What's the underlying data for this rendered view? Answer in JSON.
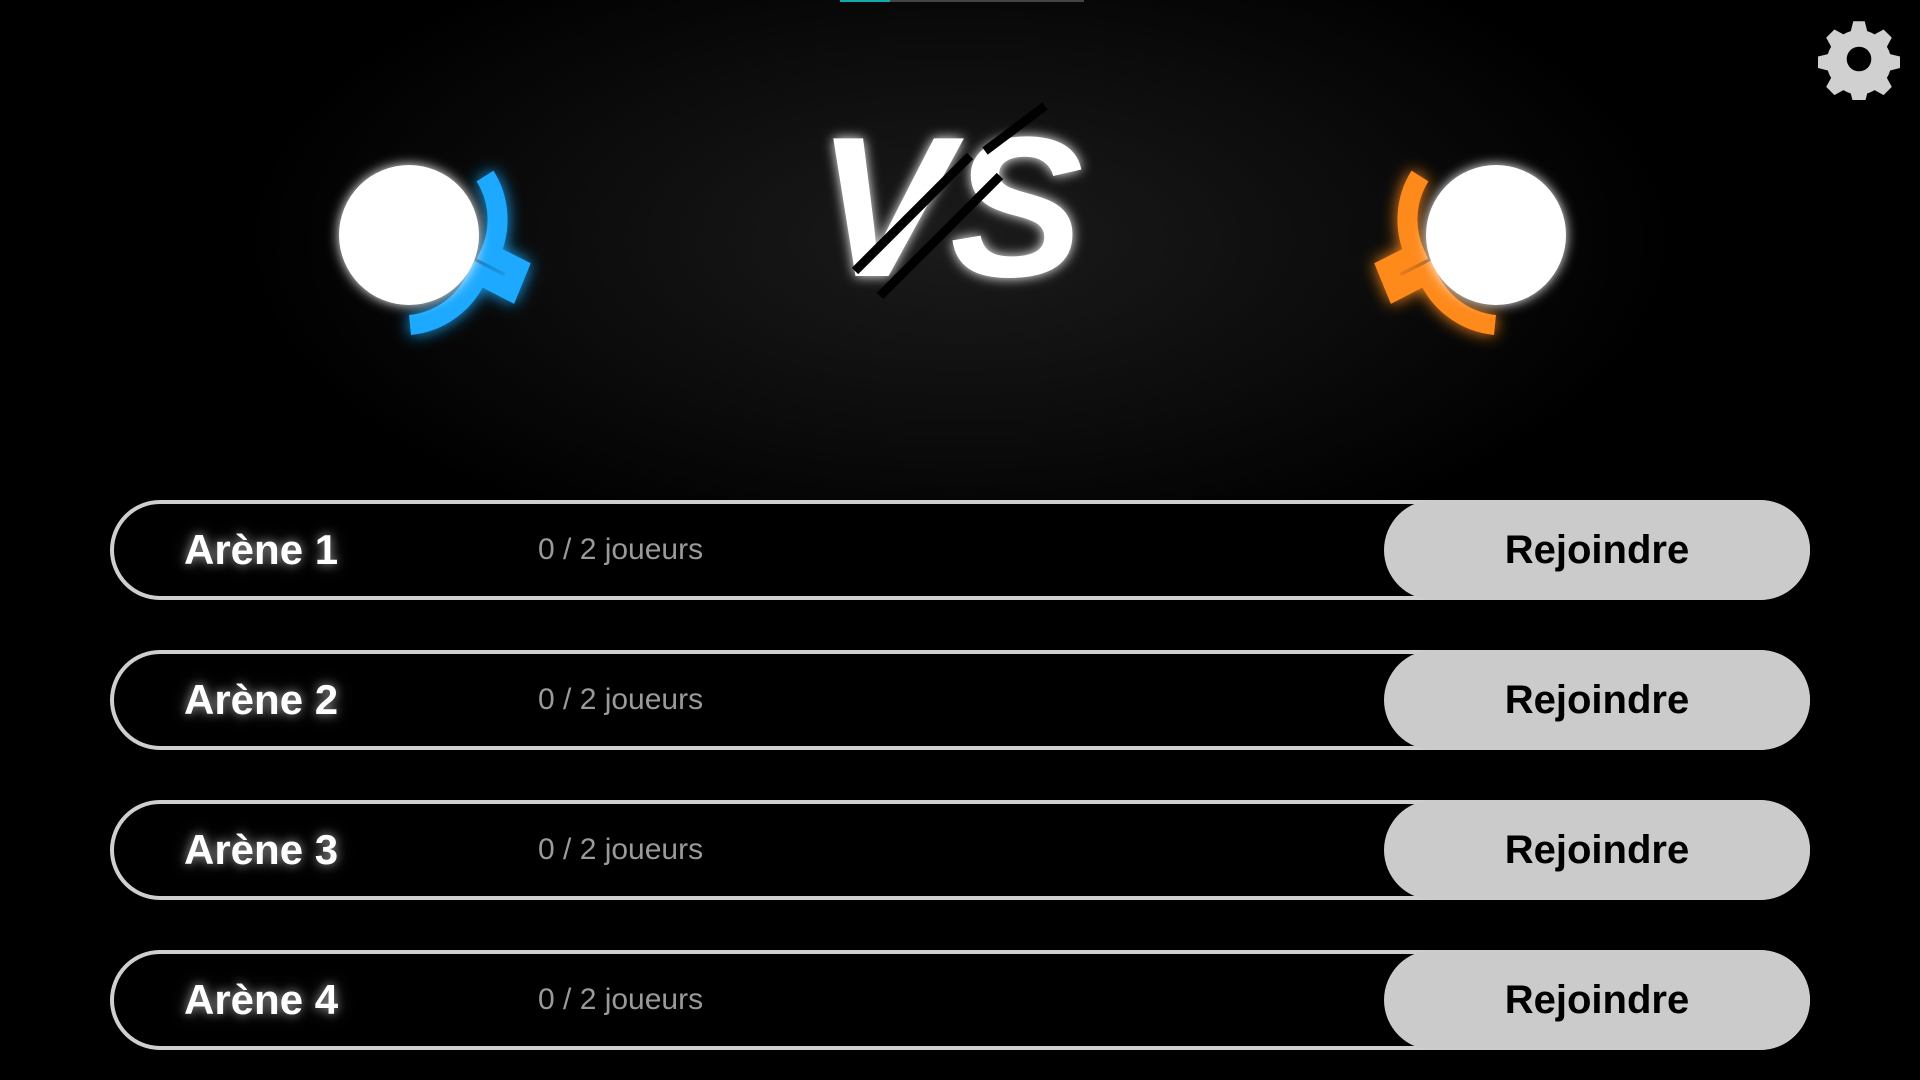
{
  "logo": {
    "text": "VS"
  },
  "settings": {
    "icon": "gear-icon",
    "color": "#d0d0d0"
  },
  "players": [
    {
      "side": "left",
      "color": "#1aa9ff",
      "icon": "player-blue-icon"
    },
    {
      "side": "right",
      "color": "#ff8a1c",
      "icon": "player-orange-icon"
    }
  ],
  "arenas": [
    {
      "name": "Arène 1",
      "players": "0 / 2 joueurs",
      "action": "Rejoindre"
    },
    {
      "name": "Arène 2",
      "players": "0 / 2 joueurs",
      "action": "Rejoindre"
    },
    {
      "name": "Arène 3",
      "players": "0 / 2 joueurs",
      "action": "Rejoindre"
    },
    {
      "name": "Arène 4",
      "players": "0 / 2 joueurs",
      "action": "Rejoindre"
    }
  ]
}
